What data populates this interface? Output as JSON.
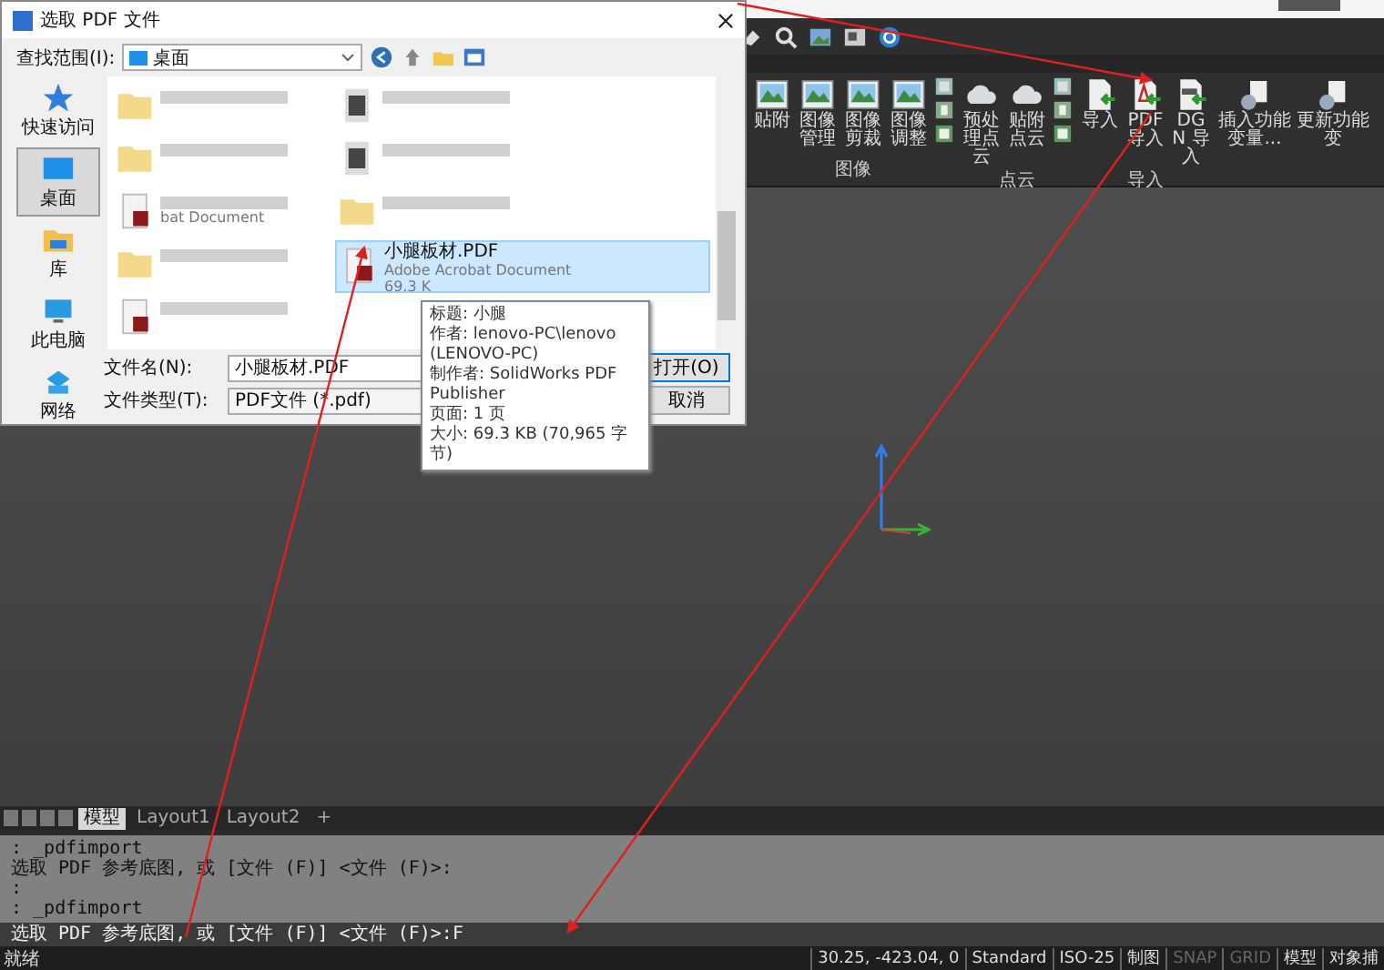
{
  "dialog": {
    "title": "选取 PDF 文件",
    "look_in_label": "查找范围(I):",
    "look_in_value": "桌面",
    "places": [
      {
        "label": "快速访问",
        "kind": "star",
        "selected": false
      },
      {
        "label": "桌面",
        "kind": "desktop",
        "selected": true
      },
      {
        "label": "库",
        "kind": "library",
        "selected": false
      },
      {
        "label": "此电脑",
        "kind": "computer",
        "selected": false
      },
      {
        "label": "网络",
        "kind": "network",
        "selected": false
      }
    ],
    "files": [
      {
        "kind": "folder",
        "selected": false
      },
      {
        "kind": "image",
        "selected": false
      },
      {
        "kind": "folder",
        "selected": false
      },
      {
        "kind": "image",
        "selected": false
      },
      {
        "kind": "pdf",
        "type": "bat Document",
        "selected": false
      },
      {
        "kind": "folder",
        "selected": false
      },
      {
        "kind": "folder",
        "selected": false
      },
      {
        "kind": "pdf",
        "name": "小腿板材.PDF",
        "type": "Adobe Acrobat Document",
        "size": "69.3 K",
        "selected": true
      },
      {
        "kind": "pdf",
        "selected": false
      }
    ],
    "tooltip": [
      "标题: 小腿",
      "作者: lenovo-PC\\lenovo (LENOVO-PC)",
      "制作者: SolidWorks PDF Publisher",
      "页面: 1 页",
      "大小: 69.3 KB (70,965 字节)"
    ],
    "file_name_label": "文件名(N):",
    "file_name_value": "小腿板材.PDF",
    "file_type_label": "文件类型(T):",
    "file_type_value": "PDF文件 (*.pdf)",
    "buttons": [
      "打开(O)",
      "取消"
    ]
  },
  "ribbon": {
    "panels": [
      {
        "title": "图像",
        "items": [
          {
            "kind": "image",
            "label": "贴附"
          },
          {
            "kind": "image",
            "label": "图像管理"
          },
          {
            "kind": "image",
            "label": "图像剪裁"
          },
          {
            "kind": "image",
            "label": "图像调整"
          },
          {
            "kind": "stack"
          }
        ]
      },
      {
        "title": "点云",
        "items": [
          {
            "kind": "cloud",
            "label": "预处理点云"
          },
          {
            "kind": "cloud",
            "label": "贴附点云"
          },
          {
            "kind": "stack"
          }
        ]
      },
      {
        "title": "导入",
        "items": [
          {
            "kind": "doc",
            "label": "导入"
          },
          {
            "kind": "pdf",
            "label": "PDF 导入"
          },
          {
            "kind": "dgn",
            "label": "DGN 导入"
          }
        ]
      },
      {
        "items": [
          {
            "kind": "field",
            "label": "插入功能变量..."
          },
          {
            "kind": "field",
            "label": "更新功能变"
          }
        ]
      }
    ]
  },
  "layout_tabs": [
    {
      "label": "模型",
      "selected": true
    },
    {
      "label": "Layout1",
      "selected": false
    },
    {
      "label": "Layout2",
      "selected": false
    },
    {
      "label": "+",
      "selected": false
    }
  ],
  "command_history": [
    ": _pdfimport",
    "选取 PDF 参考底图, 或 [文件 (F)] <文件 (F)>:",
    ":",
    ": _pdfimport"
  ],
  "command_line": "选取 PDF 参考底图, 或 [文件 (F)] <文件 (F)>:F",
  "status_bar": {
    "message": "就绪",
    "items": [
      {
        "label": "30.25, -423.04, 0",
        "on": true
      },
      {
        "label": "Standard",
        "on": true
      },
      {
        "label": "ISO-25",
        "on": true
      },
      {
        "label": "制图",
        "on": true
      },
      {
        "label": "SNAP",
        "on": false
      },
      {
        "label": "GRID",
        "on": false
      },
      {
        "label": "模型",
        "on": true
      },
      {
        "label": "对象捕",
        "on": true
      }
    ]
  }
}
